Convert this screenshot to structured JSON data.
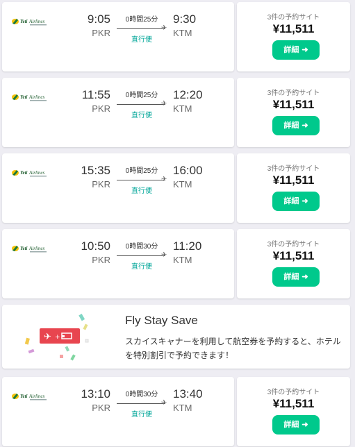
{
  "colors": {
    "accent": "#00c98c",
    "direct": "#00a698",
    "background": "#eeedf3"
  },
  "flights": [
    {
      "airline_logo": "yeti-airlines-logo",
      "dep_time": "9:05",
      "dep_code": "PKR",
      "arr_time": "9:30",
      "arr_code": "KTM",
      "duration": "0時間25分",
      "stops": "直行便",
      "sites": "3件の予約サイト",
      "price": "¥11,511",
      "button": "詳細"
    },
    {
      "airline_logo": "yeti-airlines-logo",
      "dep_time": "11:55",
      "dep_code": "PKR",
      "arr_time": "12:20",
      "arr_code": "KTM",
      "duration": "0時間25分",
      "stops": "直行便",
      "sites": "3件の予約サイト",
      "price": "¥11,511",
      "button": "詳細"
    },
    {
      "airline_logo": "yeti-airlines-logo",
      "dep_time": "15:35",
      "dep_code": "PKR",
      "arr_time": "16:00",
      "arr_code": "KTM",
      "duration": "0時間25分",
      "stops": "直行便",
      "sites": "3件の予約サイト",
      "price": "¥11,511",
      "button": "詳細"
    },
    {
      "airline_logo": "yeti-airlines-logo",
      "dep_time": "10:50",
      "dep_code": "PKR",
      "arr_time": "11:20",
      "arr_code": "KTM",
      "duration": "0時間30分",
      "stops": "直行便",
      "sites": "3件の予約サイト",
      "price": "¥11,511",
      "button": "詳細"
    },
    {
      "airline_logo": "yeti-airlines-logo",
      "dep_time": "13:10",
      "dep_code": "PKR",
      "arr_time": "13:40",
      "arr_code": "KTM",
      "duration": "0時間30分",
      "stops": "直行便",
      "sites": "3件の予約サイト",
      "price": "¥11,511",
      "button": "詳細"
    }
  ],
  "promo": {
    "title": "Fly Stay Save",
    "description": "スカイスキャナーを利用して航空券を予約すると、ホテルを特別割引で予約できます！",
    "icons": [
      "airplane-icon",
      "plus-icon",
      "bed-icon"
    ]
  }
}
